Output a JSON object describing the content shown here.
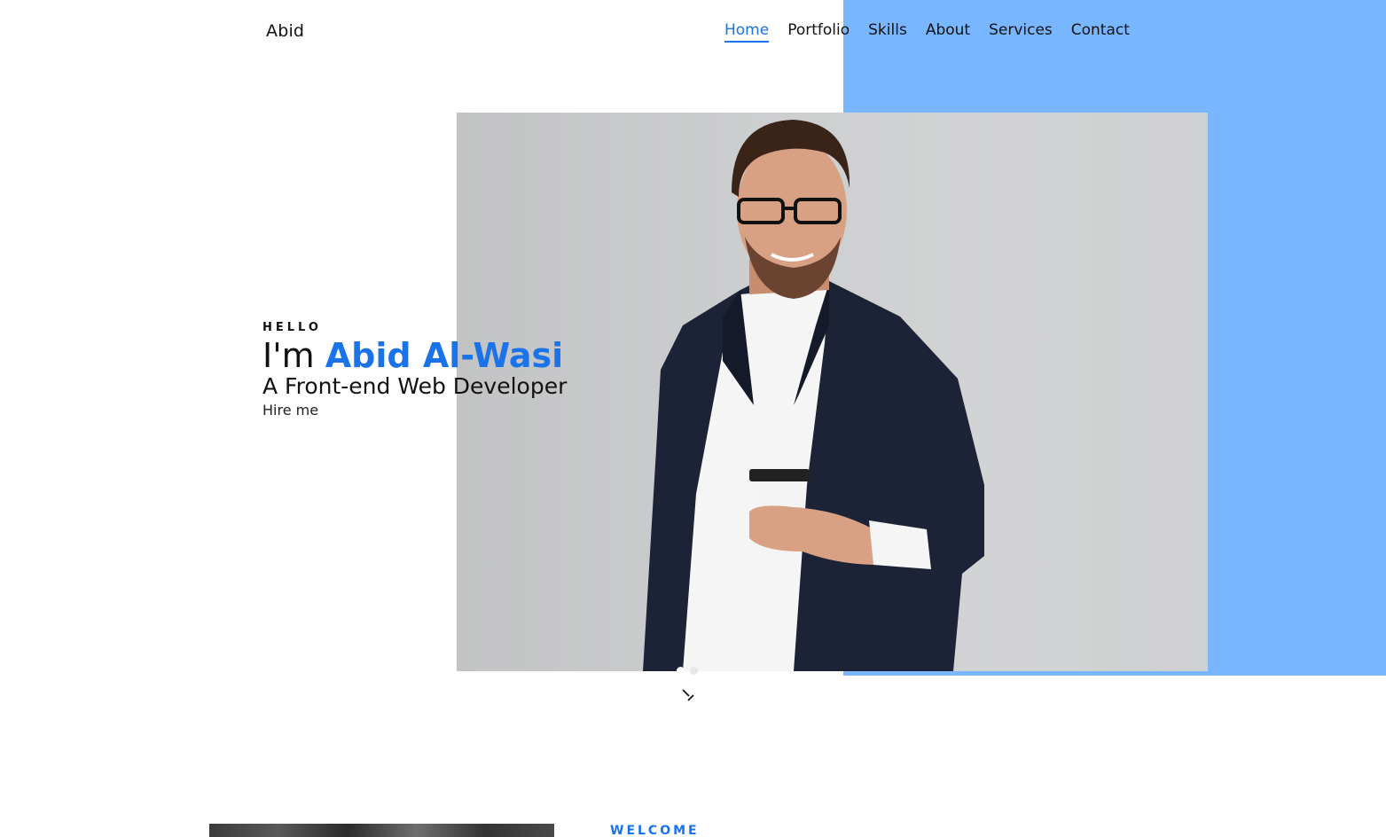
{
  "brand": {
    "name": "Abid"
  },
  "nav": {
    "items": [
      {
        "label": "Home",
        "active": true
      },
      {
        "label": "Portfolio",
        "active": false
      },
      {
        "label": "Skills",
        "active": false
      },
      {
        "label": "About",
        "active": false
      },
      {
        "label": "Services",
        "active": false
      },
      {
        "label": "Contact",
        "active": false
      }
    ]
  },
  "hero": {
    "greeting": "HELLO",
    "intro_prefix": "I'm",
    "name": "Abid Al-Wasi",
    "role": "A Front-end Web Developer",
    "cta_label": "Hire me",
    "slider_total": 2,
    "slider_active_index": 0
  },
  "welcome": {
    "label": "WELCOME"
  },
  "colors": {
    "accent": "#1a73e8",
    "panel_blue": "#78b6ff",
    "text": "#111111"
  },
  "icons": {
    "scroll": "scroll-down-icon"
  }
}
